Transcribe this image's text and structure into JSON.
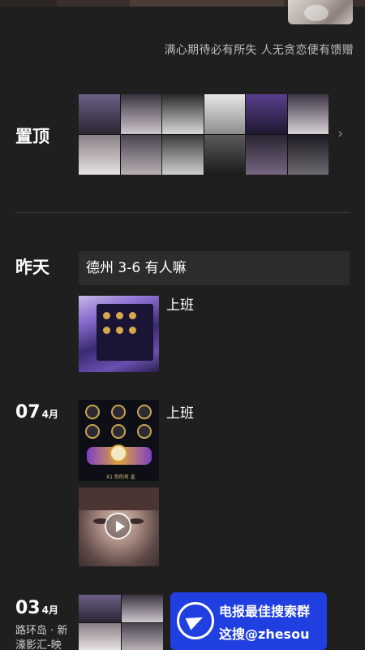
{
  "profile": {
    "signature": "满心期待必有所失 人无贪恋便有馈赠"
  },
  "pinned": {
    "label": "置顶",
    "thumbnails": [
      "photo-set-1",
      "photo-set-2",
      "photo-set-3"
    ],
    "more_icon": "chevron-right-icon"
  },
  "yesterday": {
    "label": "昨天",
    "text_post": "德州 3-6 有人嘛",
    "image_post_caption": "上班"
  },
  "apr07": {
    "day": "07",
    "month": "4月",
    "caption": "上班",
    "game_caption": "X1 你的名 皇"
  },
  "apr03": {
    "day": "03",
    "month": "4月",
    "location": "路环岛 · 新濠影汇-映"
  },
  "watermark": {
    "line1": "电报最佳搜索群",
    "line2": "这搜@zhesou"
  },
  "colors": {
    "background": "#1f1f1f",
    "watermark_blue": "#1f3fe0"
  }
}
